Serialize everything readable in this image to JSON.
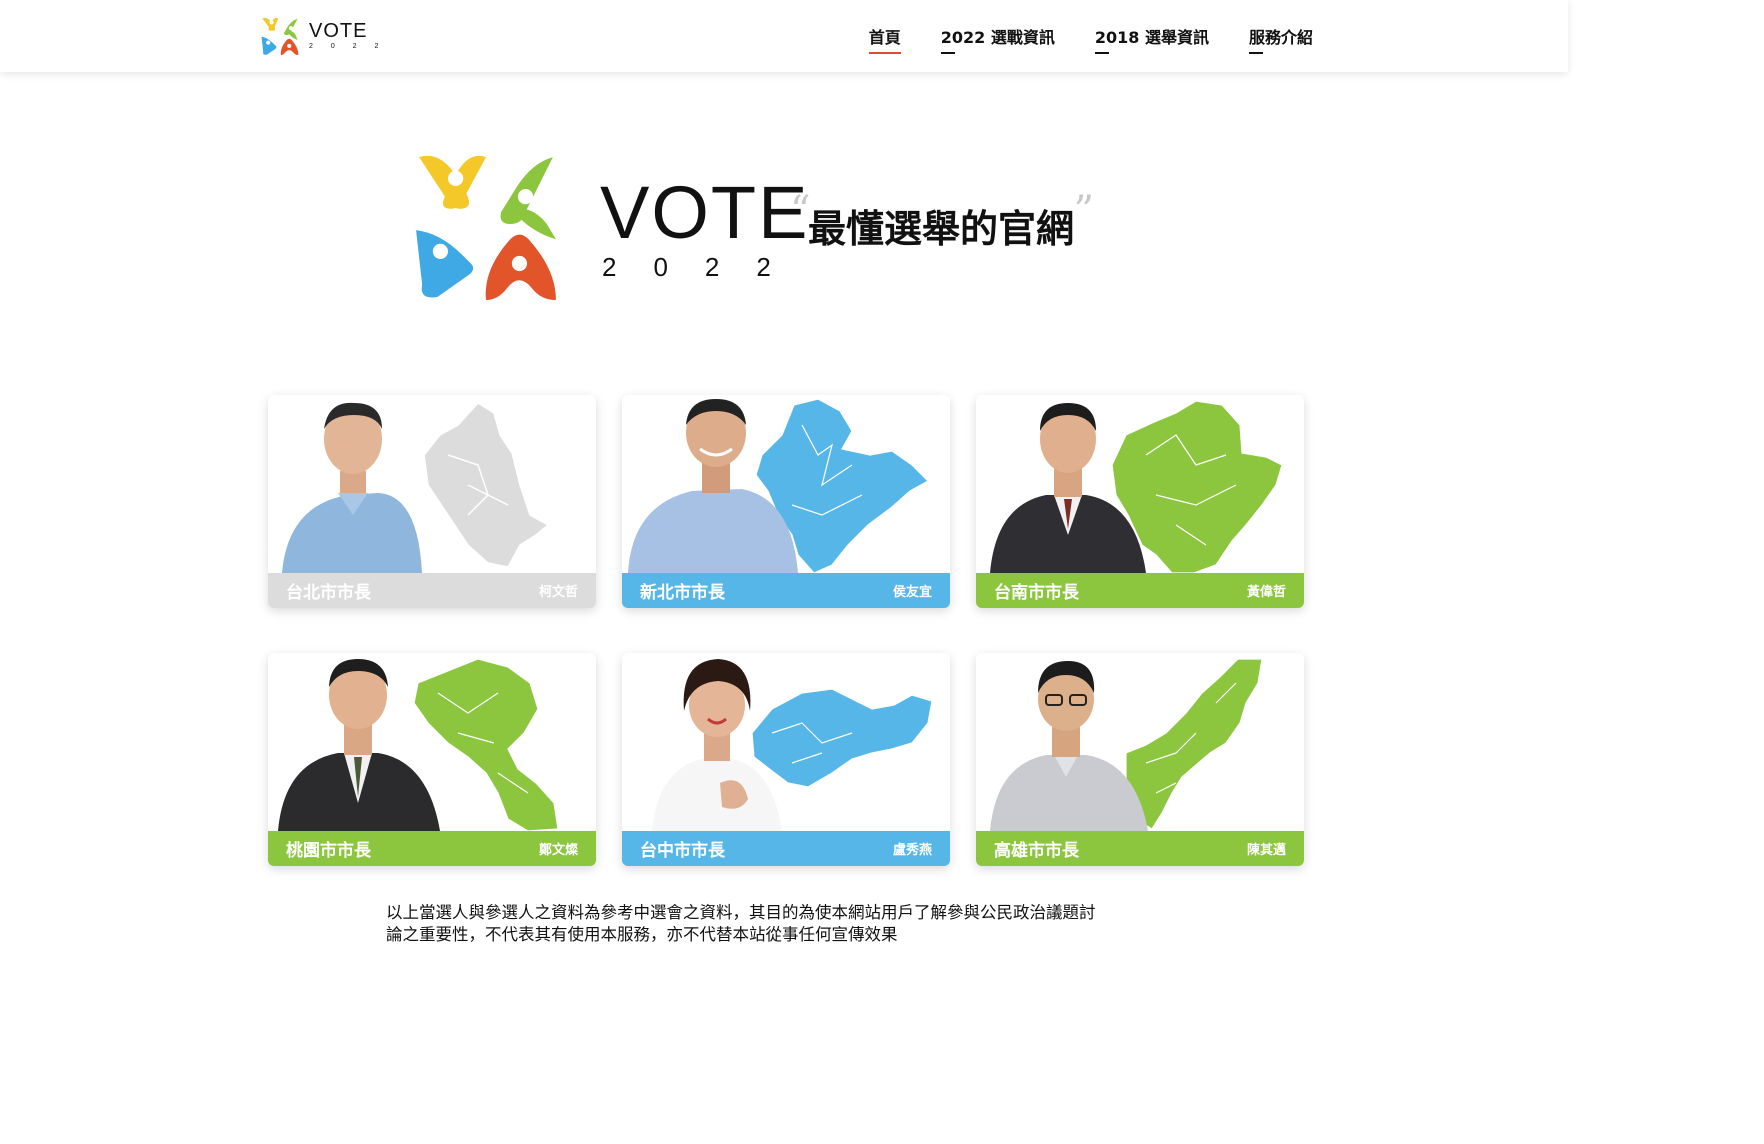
{
  "header": {
    "brand": {
      "wordmark": "VOTE",
      "year": "2 0 2 2"
    },
    "nav": [
      {
        "label": "首頁",
        "active": true
      },
      {
        "label": "2022 選戰資訊",
        "active": false
      },
      {
        "label": "2018 選舉資訊",
        "active": false
      },
      {
        "label": "服務介紹",
        "active": false
      }
    ]
  },
  "hero": {
    "wordmark": "VOTE",
    "year": "2022",
    "quote_open": "“",
    "tagline": "最懂選舉的官網",
    "quote_close": "”"
  },
  "colors": {
    "gray": "#dcdcdc",
    "blue": "#57b6e8",
    "green": "#8cc63f",
    "logo_yellow": "#f5c82a",
    "logo_green": "#8cc63f",
    "logo_blue": "#3fa9e6",
    "logo_red": "#e2552a",
    "active_underline": "#e04a2e"
  },
  "cards": [
    {
      "title": "台北市市長",
      "name": "柯文哲",
      "color": "gray",
      "map_icon": "taipei-map",
      "suit_color": "light-blue shirt"
    },
    {
      "title": "新北市市長",
      "name": "侯友宜",
      "color": "blue",
      "map_icon": "new-taipei-map",
      "suit_color": "light-blue shirt"
    },
    {
      "title": "台南市市長",
      "name": "黃偉哲",
      "color": "green",
      "map_icon": "tainan-map",
      "suit_color": "dark suit"
    },
    {
      "title": "桃園市市長",
      "name": "鄭文燦",
      "color": "green",
      "map_icon": "taoyuan-map",
      "suit_color": "dark suit"
    },
    {
      "title": "台中市市長",
      "name": "盧秀燕",
      "color": "blue",
      "map_icon": "taichung-map",
      "suit_color": "white blouse"
    },
    {
      "title": "高雄市市長",
      "name": "陳其邁",
      "color": "green",
      "map_icon": "kaohsiung-map",
      "suit_color": "light-gray shirt"
    }
  ],
  "disclaimer": {
    "line1": "以上當選人與參選人之資料為參考中選會之資料，其目的為使本網站用戶了解參與公民政治議題討",
    "line2": "論之重要性，不代表其有使用本服務，亦不代替本站從事任何宣傳效果"
  }
}
